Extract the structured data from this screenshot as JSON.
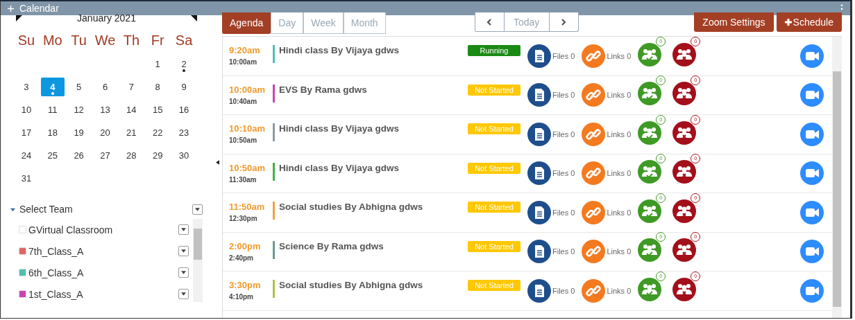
{
  "window": {
    "title": "Calendar"
  },
  "mini_calendar": {
    "month": "January 2021",
    "weekdays": [
      "Su",
      "Mo",
      "Tu",
      "We",
      "Th",
      "Fr",
      "Sa"
    ],
    "weeks": [
      [
        {
          "label": "1",
          "selected": false,
          "has_event": false
        },
        {
          "label": "2",
          "selected": false,
          "has_event": true
        }
      ],
      [
        {
          "label": "3",
          "selected": false,
          "has_event": false
        },
        {
          "label": "4",
          "selected": true,
          "has_event": true
        },
        {
          "label": "5",
          "selected": false,
          "has_event": false
        },
        {
          "label": "6",
          "selected": false,
          "has_event": false
        },
        {
          "label": "7",
          "selected": false,
          "has_event": false
        },
        {
          "label": "8",
          "selected": false,
          "has_event": false
        },
        {
          "label": "9",
          "selected": false,
          "has_event": false
        }
      ],
      [
        {
          "label": "10",
          "selected": false,
          "has_event": false
        },
        {
          "label": "11",
          "selected": false,
          "has_event": false
        },
        {
          "label": "12",
          "selected": false,
          "has_event": false
        },
        {
          "label": "13",
          "selected": false,
          "has_event": false
        },
        {
          "label": "14",
          "selected": false,
          "has_event": false
        },
        {
          "label": "15",
          "selected": false,
          "has_event": false
        },
        {
          "label": "16",
          "selected": false,
          "has_event": false
        }
      ],
      [
        {
          "label": "17",
          "selected": false,
          "has_event": false
        },
        {
          "label": "18",
          "selected": false,
          "has_event": false
        },
        {
          "label": "19",
          "selected": false,
          "has_event": false
        },
        {
          "label": "20",
          "selected": false,
          "has_event": false
        },
        {
          "label": "21",
          "selected": false,
          "has_event": false
        },
        {
          "label": "22",
          "selected": false,
          "has_event": false
        },
        {
          "label": "23",
          "selected": false,
          "has_event": false
        }
      ],
      [
        {
          "label": "24",
          "selected": false,
          "has_event": false
        },
        {
          "label": "25",
          "selected": false,
          "has_event": false
        },
        {
          "label": "26",
          "selected": false,
          "has_event": false
        },
        {
          "label": "27",
          "selected": false,
          "has_event": false
        },
        {
          "label": "28",
          "selected": false,
          "has_event": false
        },
        {
          "label": "29",
          "selected": false,
          "has_event": false
        },
        {
          "label": "30",
          "selected": false,
          "has_event": false
        }
      ],
      [
        {
          "label": "31",
          "selected": false,
          "has_event": false
        }
      ]
    ]
  },
  "teams": {
    "title": "Select Team",
    "expanded": true,
    "items": [
      {
        "name": "GVirtual Classroom",
        "color": "#ffffff"
      },
      {
        "name": "7th_Class_A",
        "color": "#e06666"
      },
      {
        "name": "6th_Class_A",
        "color": "#4fc0b0"
      },
      {
        "name": "1st_Class_A",
        "color": "#c944b0"
      }
    ]
  },
  "view_tabs": [
    {
      "label": "Agenda",
      "selected": true
    },
    {
      "label": "Day",
      "selected": false
    },
    {
      "label": "Week",
      "selected": false
    },
    {
      "label": "Month",
      "selected": false
    }
  ],
  "nav": {
    "today": "Today"
  },
  "actions": {
    "zoom_settings": "Zoom Settings",
    "schedule": "Schedule"
  },
  "events": [
    {
      "start": "9:20am",
      "end": "10:00am",
      "title": "Hindi class By Vijaya gdws",
      "color": "#4fc0b0",
      "status": {
        "label": "Running",
        "color": "#1a8a14"
      },
      "files": "Files 0",
      "links": "Links 0",
      "present": "0",
      "absent": "0"
    },
    {
      "start": "10:00am",
      "end": "10:40am",
      "title": "EVS By Rama gdws",
      "color": "#c944b0",
      "status": {
        "label": "Not Started",
        "color": "#ffc800"
      },
      "files": "Files 0",
      "links": "Links 0",
      "present": "0",
      "absent": "0"
    },
    {
      "start": "10:10am",
      "end": "10:50am",
      "title": "Hindi class By Vijaya gdws",
      "color": "#8a9aa0",
      "status": {
        "label": "Not Started",
        "color": "#ffc800"
      },
      "files": "Files 0",
      "links": "Links 0",
      "present": "0",
      "absent": "0"
    },
    {
      "start": "10:50am",
      "end": "11:30am",
      "title": "Hindi class By Vijaya gdws",
      "color": "#44b044",
      "status": {
        "label": "Not Started",
        "color": "#ffc800"
      },
      "files": "Files 0",
      "links": "Links 0",
      "present": "0",
      "absent": "0"
    },
    {
      "start": "11:50am",
      "end": "12:30pm",
      "title": "Social studies By Abhigna gdws",
      "color": "#f0a040",
      "status": {
        "label": "Not Started",
        "color": "#ffc800"
      },
      "files": "Files 0",
      "links": "Links 0",
      "present": "0",
      "absent": "0"
    },
    {
      "start": "2:00pm",
      "end": "2:40pm",
      "title": "Science By Rama gdws",
      "color": "#6a9a90",
      "status": {
        "label": "Not Started",
        "color": "#ffc800"
      },
      "files": "Files 0",
      "links": "Links 0",
      "present": "0",
      "absent": "0"
    },
    {
      "start": "3:30pm",
      "end": "4:10pm",
      "title": "Social studies By Abhigna gdws",
      "color": "#b0c040",
      "status": {
        "label": "Not Started",
        "color": "#ffc800"
      },
      "files": "Files 0",
      "links": "Links 0",
      "present": "0",
      "absent": "0"
    }
  ]
}
